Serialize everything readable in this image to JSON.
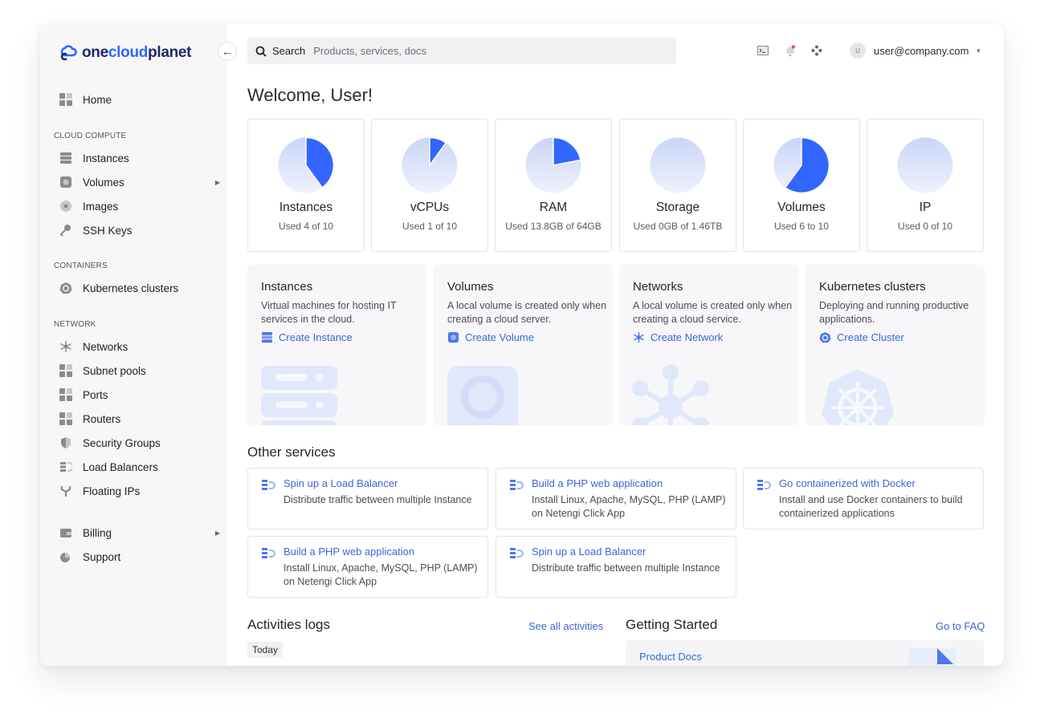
{
  "brand": {
    "part1": "one",
    "part2": "cloud",
    "part3": "planet"
  },
  "sidebar": {
    "home": "Home",
    "sections": [
      {
        "label": "CLOUD COMPUTE",
        "items": [
          "Instances",
          "Volumes",
          "Images",
          "SSH Keys"
        ]
      },
      {
        "label": "CONTAINERS",
        "items": [
          "Kubernetes clusters"
        ]
      },
      {
        "label": "NETWORK",
        "items": [
          "Networks",
          "Subnet pools",
          "Ports",
          "Routers",
          "Security Groups",
          "Load Balancers",
          "Floating IPs"
        ]
      }
    ],
    "bottom": [
      "Billing",
      "Support"
    ]
  },
  "search": {
    "label": "Search",
    "placeholder": "Products, services, docs"
  },
  "user": {
    "initial": "U",
    "email": "user@company.com"
  },
  "welcome": "Welcome, User!",
  "usage": [
    {
      "name": "Instances",
      "used": "Used 4 of 10",
      "fraction": 0.4
    },
    {
      "name": "vCPUs",
      "used": "Used 1 of 10",
      "fraction": 0.1
    },
    {
      "name": "RAM",
      "used": "Used 13.8GB of 64GB",
      "fraction": 0.22
    },
    {
      "name": "Storage",
      "used": "Used 0GB of 1.46TB",
      "fraction": 0
    },
    {
      "name": "Volumes",
      "used": "Used 6 to 10",
      "fraction": 0.6
    },
    {
      "name": "IP",
      "used": "Used 0 of 10",
      "fraction": 0
    }
  ],
  "services": [
    {
      "title": "Instances",
      "desc": "Virtual machines for hosting IT services in the cloud.",
      "link": "Create Instance",
      "icon": "server-icon"
    },
    {
      "title": "Volumes",
      "desc": "A local volume is created only when creating a cloud server.",
      "link": "Create Volume",
      "icon": "volume-icon"
    },
    {
      "title": "Networks",
      "desc": "A local volume is created only when creating a cloud service.",
      "link": "Create Network",
      "icon": "network-icon"
    },
    {
      "title": "Kubernetes clusters",
      "desc": "Deploying and running productive applications.",
      "link": "Create Cluster",
      "icon": "kubernetes-icon"
    }
  ],
  "other_title": "Other services",
  "other": [
    {
      "title": "Spin up a Load Balancer",
      "desc": "Distribute traffic between multiple Instance"
    },
    {
      "title": "Build a PHP web application",
      "desc": "Install Linux, Apache, MySQL, PHP (LAMP) on Netengi Click App"
    },
    {
      "title": "Go containerized with Docker",
      "desc": "Install and use Docker containers to build containerized applications"
    },
    {
      "title": "Build a PHP web application",
      "desc": "Install Linux, Apache, MySQL, PHP (LAMP) on Netengi Click App"
    },
    {
      "title": "Spin up a Load Balancer",
      "desc": "Distribute traffic between multiple Instance"
    }
  ],
  "activities": {
    "title": "Activities logs",
    "link": "See all activities",
    "today": "Today"
  },
  "getting_started": {
    "title": "Getting Started",
    "link": "Go to FAQ",
    "doc": "Product Docs"
  },
  "colors": {
    "accent": "#3366ff",
    "link": "#3a66d8",
    "pie_bg": "#dfe7fb"
  }
}
